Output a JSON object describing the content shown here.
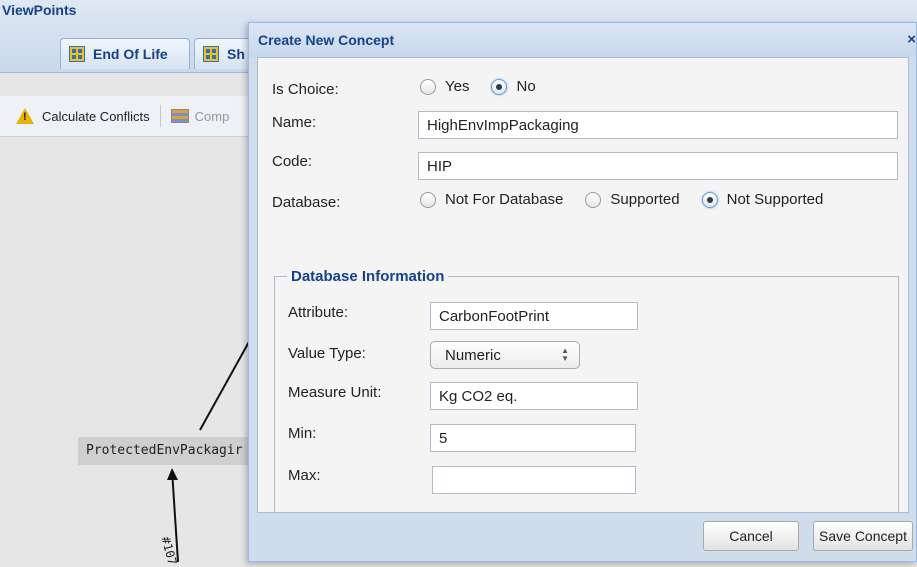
{
  "background": {
    "viewpoints_title": "ViewPoints",
    "tabs": [
      {
        "label": "End Of Life"
      },
      {
        "label": "Sh"
      }
    ],
    "toolbar": {
      "calculate_conflicts": "Calculate Conflicts",
      "compare": "Comp"
    },
    "graph": {
      "node_label": "ProtectedEnvPackagir",
      "edge_label": "#107"
    }
  },
  "dialog": {
    "title": "Create New Concept",
    "close_symbol": "×",
    "is_choice": {
      "label": "Is Choice:",
      "options": [
        "Yes",
        "No"
      ],
      "selected": "No"
    },
    "name": {
      "label": "Name:",
      "value": "HighEnvImpPackaging"
    },
    "code": {
      "label": "Code:",
      "value": "HIP"
    },
    "database": {
      "label": "Database:",
      "options": [
        "Not For Database",
        "Supported",
        "Not Supported"
      ],
      "selected": "Not Supported"
    },
    "database_information": {
      "legend": "Database Information",
      "attribute": {
        "label": "Attribute:",
        "value": "CarbonFootPrint"
      },
      "value_type": {
        "label": "Value Type:",
        "value": "Numeric"
      },
      "measure_unit": {
        "label": "Measure Unit:",
        "value": "Kg CO2 eq."
      },
      "min": {
        "label": "Min:",
        "value": "5"
      },
      "max": {
        "label": "Max:",
        "value": ""
      }
    },
    "buttons": {
      "cancel": "Cancel",
      "save": "Save Concept"
    }
  }
}
